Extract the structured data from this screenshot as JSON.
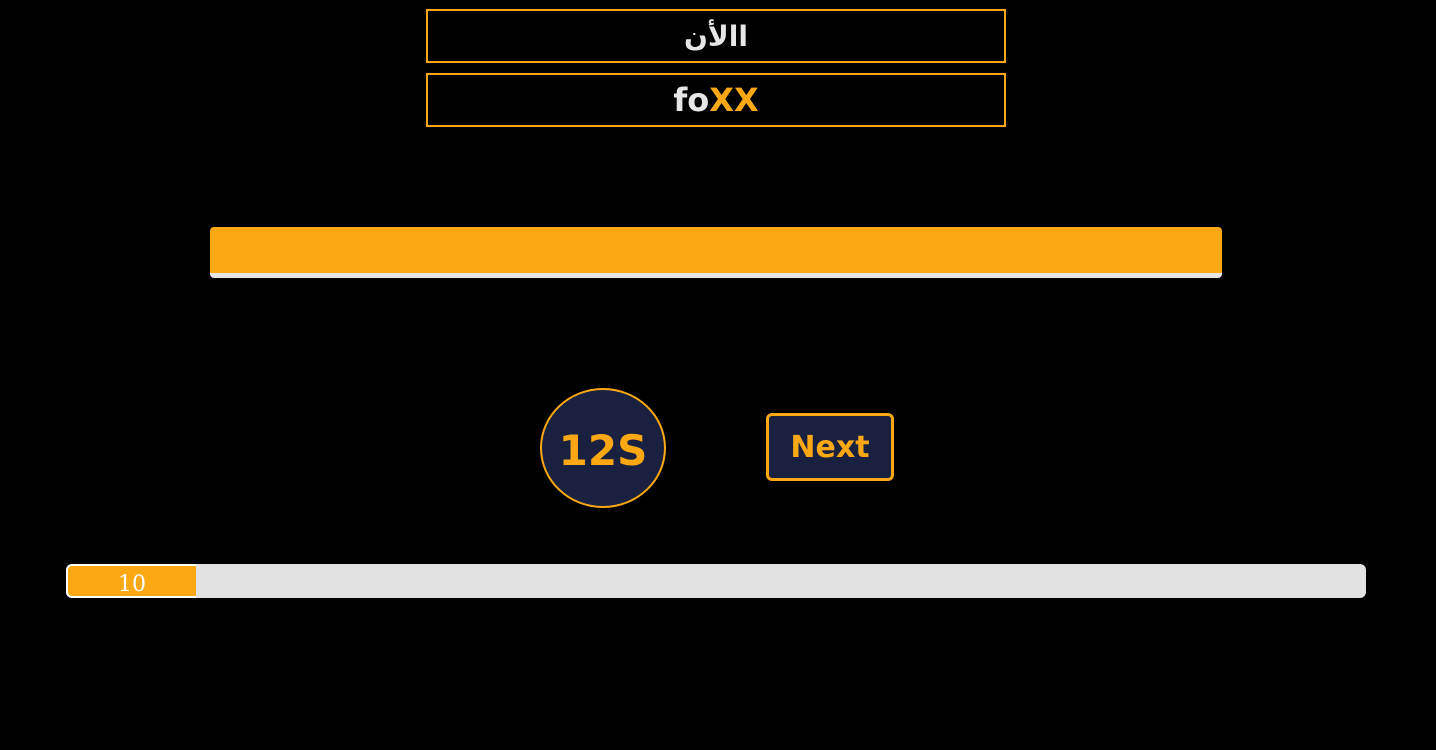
{
  "question": {
    "word": "االأن",
    "logo_part1": "fo",
    "logo_part2": "XX"
  },
  "answer_bar": {
    "color": "#fca815"
  },
  "timer": {
    "text": "12S"
  },
  "next_button": {
    "label": "Next"
  },
  "progress": {
    "label": "10",
    "fraction": 0.1
  },
  "colors": {
    "accent": "#fca815",
    "background": "#000000",
    "panel": "#1a2140",
    "track": "#e2e2e2"
  }
}
